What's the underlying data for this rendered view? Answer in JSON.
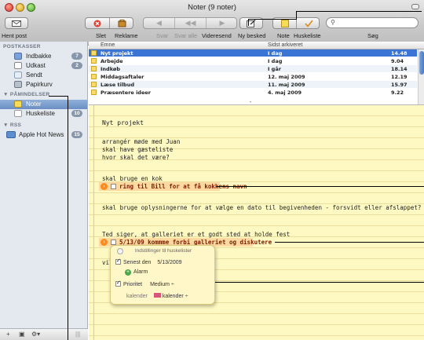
{
  "window": {
    "title": "Noter (9 noter)"
  },
  "toolbar": {
    "hent_post": "Hent post",
    "slet": "Slet",
    "reklame": "Reklame",
    "svar": "Svar",
    "svar_alle": "Svar alle",
    "videresend": "Videresend",
    "ny_besked": "Ny besked",
    "note": "Note",
    "huskeliste": "Huskeliste",
    "soeg": "Søg",
    "search_value": ""
  },
  "sidebar": {
    "postkasser_heading": "POSTKASSER",
    "mailboxes": [
      {
        "label": "Indbakke",
        "count": "7"
      },
      {
        "label": "Udkast",
        "count": "2"
      },
      {
        "label": "Sendt",
        "count": ""
      },
      {
        "label": "Papirkurv",
        "count": ""
      }
    ],
    "paamindelser_heading": "PÅMINDELSER",
    "reminders": [
      {
        "label": "Noter",
        "count": ""
      },
      {
        "label": "Huskeliste",
        "count": "10"
      }
    ],
    "rss_heading": "RSS",
    "feeds": [
      {
        "label": "Apple Hot News",
        "count": "15"
      }
    ]
  },
  "list": {
    "col_subject": "Emne",
    "col_date": "Sidst arkiveret",
    "rows": [
      {
        "subject": "Nyt projekt",
        "date": "I dag",
        "time": "14.48"
      },
      {
        "subject": "Arbejde",
        "date": "I dag",
        "time": "9.04"
      },
      {
        "subject": "Indkøb",
        "date": "I går",
        "time": "18.14"
      },
      {
        "subject": "Middagsaftaler",
        "date": "12. maj 2009",
        "time": "12.19"
      },
      {
        "subject": "Læse tilbud",
        "date": "11. maj 2009",
        "time": "15.97"
      },
      {
        "subject": "Præsentere ideer",
        "date": "4. maj 2009",
        "time": "9.22"
      }
    ]
  },
  "note": {
    "title": "Nyt projekt",
    "line1": "arrangér møde med Juan",
    "line2": "skal have gæsteliste",
    "line3": "hvor skal det være?",
    "line4": "skal bruge en kok",
    "todo1": "ring til Bill for at få kokkens navn",
    "line5": "skal bruge oplysningerne for at vælge en dato til begivenheden - forsvidt eller afslappet?",
    "line6": "Ted siger, at galleriet er et godt sted at holde fest",
    "todo2": "5/13/09  kommme forbi galleriet og diskutere",
    "line7": "vil"
  },
  "popup": {
    "title": "Indstillinger til huskelister",
    "due_label": "Senest den",
    "due_value": "5/13/2009",
    "alarm_label": "Alarm",
    "priority_label": "Prioritet",
    "priority_value": "Medium ÷",
    "calendar_label": "kalender",
    "calendar_value": "kalender ÷"
  }
}
